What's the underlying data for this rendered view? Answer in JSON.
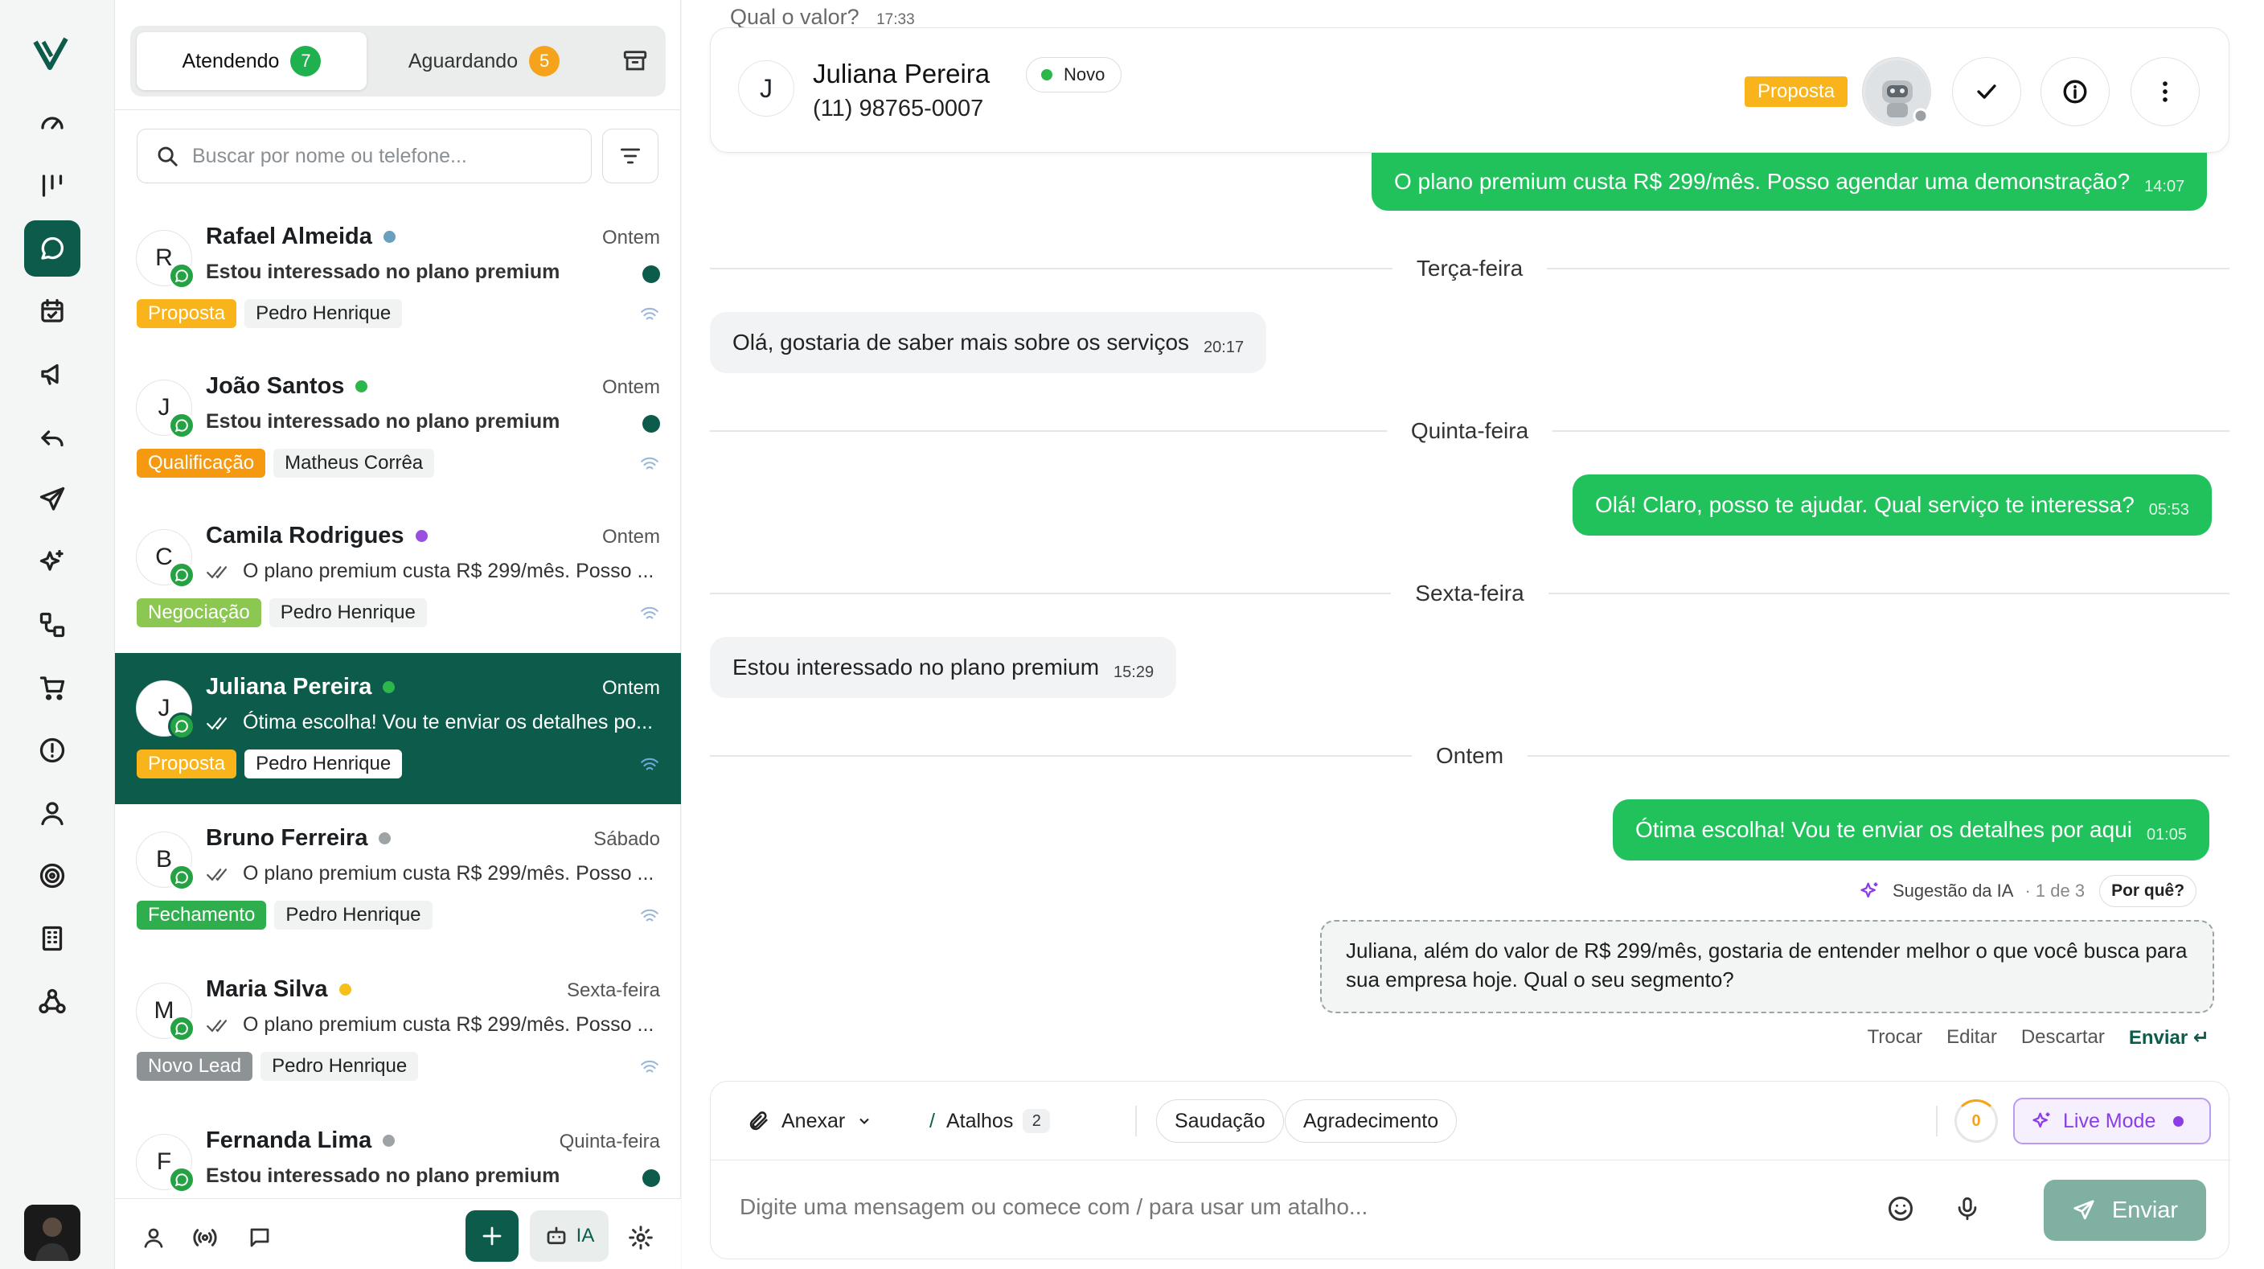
{
  "rail": {
    "items": [
      "dashboard",
      "kanban",
      "chat",
      "calendar",
      "campaigns",
      "reply",
      "send",
      "ai",
      "flows",
      "cart",
      "alert",
      "contacts",
      "target",
      "building",
      "webhooks"
    ]
  },
  "list": {
    "tabs": {
      "active_label": "Atendendo",
      "active_count": "7",
      "waiting_label": "Aguardando",
      "waiting_count": "5"
    },
    "search_placeholder": "Buscar por nome ou telefone...",
    "conversations": [
      {
        "initial": "R",
        "name": "Rafael Almeida",
        "time": "Ontem",
        "message": "Estou interessado no plano premium",
        "tag": "Proposta",
        "agent": "Pedro Henrique"
      },
      {
        "initial": "J",
        "name": "João Santos",
        "time": "Ontem",
        "message": "Estou interessado no plano premium",
        "tag": "Qualificação",
        "agent": "Matheus Corrêa"
      },
      {
        "initial": "C",
        "name": "Camila Rodrigues",
        "time": "Ontem",
        "message": "O plano premium custa R$ 299/mês. Posso ...",
        "tag": "Negociação",
        "agent": "Pedro Henrique"
      },
      {
        "initial": "J",
        "name": "Juliana Pereira",
        "time": "Ontem",
        "message": "Ótima escolha! Vou te enviar os detalhes po...",
        "tag": "Proposta",
        "agent": "Pedro Henrique"
      },
      {
        "initial": "B",
        "name": "Bruno Ferreira",
        "time": "Sábado",
        "message": "O plano premium custa R$ 299/mês. Posso ...",
        "tag": "Fechamento",
        "agent": "Pedro Henrique"
      },
      {
        "initial": "M",
        "name": "Maria Silva",
        "time": "Sexta-feira",
        "message": "O plano premium custa R$ 299/mês. Posso ...",
        "tag": "Novo Lead",
        "agent": "Pedro Henrique"
      },
      {
        "initial": "F",
        "name": "Fernanda Lima",
        "time": "Quinta-feira",
        "message": "Estou interessado no plano premium",
        "tag": "",
        "agent": ""
      }
    ],
    "footer": {
      "ai_label": "IA"
    }
  },
  "chat": {
    "header": {
      "initial": "J",
      "name": "Juliana Pereira",
      "status": "Novo",
      "phone": "(11) 98765-0007",
      "stage": "Proposta",
      "peek_text": "Qual o valor?",
      "peek_time": "17:33"
    },
    "messages": [
      {
        "text": "O plano premium custa R$ 299/mês. Posso agendar uma demonstração?",
        "time": "14:07"
      },
      {
        "separator": "Terça-feira"
      },
      {
        "text": "Olá, gostaria de saber mais sobre os serviços",
        "time": "20:17"
      },
      {
        "separator": "Quinta-feira"
      },
      {
        "text": "Olá! Claro, posso te ajudar. Qual serviço te interessa?",
        "time": "05:53"
      },
      {
        "separator": "Sexta-feira"
      },
      {
        "text": "Estou interessado no plano premium",
        "time": "15:29"
      },
      {
        "separator": "Ontem"
      },
      {
        "text": "Ótima escolha! Vou te enviar os detalhes por aqui",
        "time": "01:05"
      }
    ],
    "ai_suggestion": {
      "label": "Sugestão da IA",
      "counter": "· 1 de 3",
      "why": "Por quê?",
      "text": "Juliana, além do valor de R$ 299/mês, gostaria de entender melhor o que você busca para sua empresa hoje. Qual o seu segmento?",
      "actions": {
        "swap": "Trocar",
        "edit": "Editar",
        "discard": "Descartar",
        "send": "Enviar ↵"
      }
    },
    "composer": {
      "attach": "Anexar",
      "shortcuts": "Atalhos",
      "shortcuts_count": "2",
      "quick1": "Saudação",
      "quick2": "Agradecimento",
      "score": "0",
      "live_mode": "Live Mode",
      "placeholder": "Digite uma mensagem ou comece com / para usar um atalho...",
      "send": "Enviar"
    }
  },
  "colors": {
    "brand": "#0d5c4b",
    "outgoing": "#21c15c",
    "proposta": "#f8b41a",
    "qualificacao": "#f59a10",
    "negociacao": "#8cc751",
    "fechamento": "#2fae4e",
    "novo_lead": "#8d9294",
    "live": "#8b3ee6"
  }
}
